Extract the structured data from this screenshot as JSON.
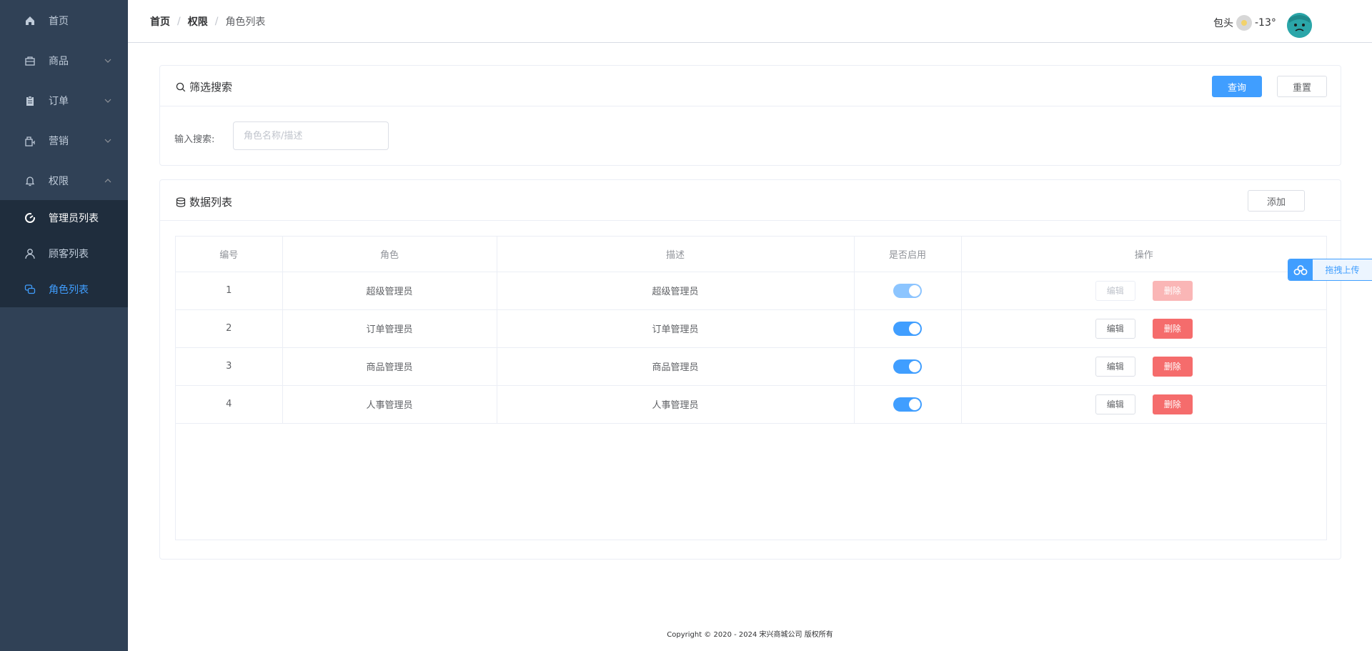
{
  "sidebar": {
    "items": [
      {
        "label": "首页",
        "icon": "home-icon",
        "has_arrow": false
      },
      {
        "label": "商品",
        "icon": "bag-icon",
        "has_arrow": true
      },
      {
        "label": "订单",
        "icon": "clipboard-icon",
        "has_arrow": true
      },
      {
        "label": "营销",
        "icon": "gift-bag-icon",
        "has_arrow": true
      },
      {
        "label": "权限",
        "icon": "bell-icon",
        "has_arrow": true,
        "expanded": true
      }
    ],
    "sub_items": [
      {
        "label": "管理员列表",
        "icon": "dashboard-icon"
      },
      {
        "label": "顾客列表",
        "icon": "user-icon"
      },
      {
        "label": "角色列表",
        "icon": "chat-icon",
        "active": true
      }
    ]
  },
  "header": {
    "breadcrumb": [
      "首页",
      "权限",
      "角色列表"
    ],
    "breadcrumb_sep": "/",
    "weather_city": "包头",
    "weather_temp": "-13°"
  },
  "filter": {
    "title": "筛选搜索",
    "query_label": "查询",
    "reset_label": "重置",
    "input_label": "输入搜索:",
    "input_placeholder": "角色名称/描述",
    "input_value": ""
  },
  "list": {
    "title": "数据列表",
    "add_label": "添加",
    "columns": [
      "编号",
      "角色",
      "描述",
      "是否启用",
      "操作"
    ],
    "rows": [
      {
        "id": "1",
        "role": "超级管理员",
        "desc": "超级管理员",
        "enabled": true,
        "locked": true
      },
      {
        "id": "2",
        "role": "订单管理员",
        "desc": "订单管理员",
        "enabled": true,
        "locked": false
      },
      {
        "id": "3",
        "role": "商品管理员",
        "desc": "商品管理员",
        "enabled": true,
        "locked": false
      },
      {
        "id": "4",
        "role": "人事管理员",
        "desc": "人事管理员",
        "enabled": true,
        "locked": false
      }
    ],
    "edit_label": "编辑",
    "delete_label": "删除"
  },
  "upload_tab": {
    "label": "拖拽上传"
  },
  "footer": {
    "text": "Copyright © 2020 - 2024  宋兴商城公司 版权所有"
  },
  "colors": {
    "sidebar_bg": "#304156",
    "submenu_bg": "#1f2d3d",
    "primary": "#409eff",
    "danger": "#f56c6c"
  }
}
